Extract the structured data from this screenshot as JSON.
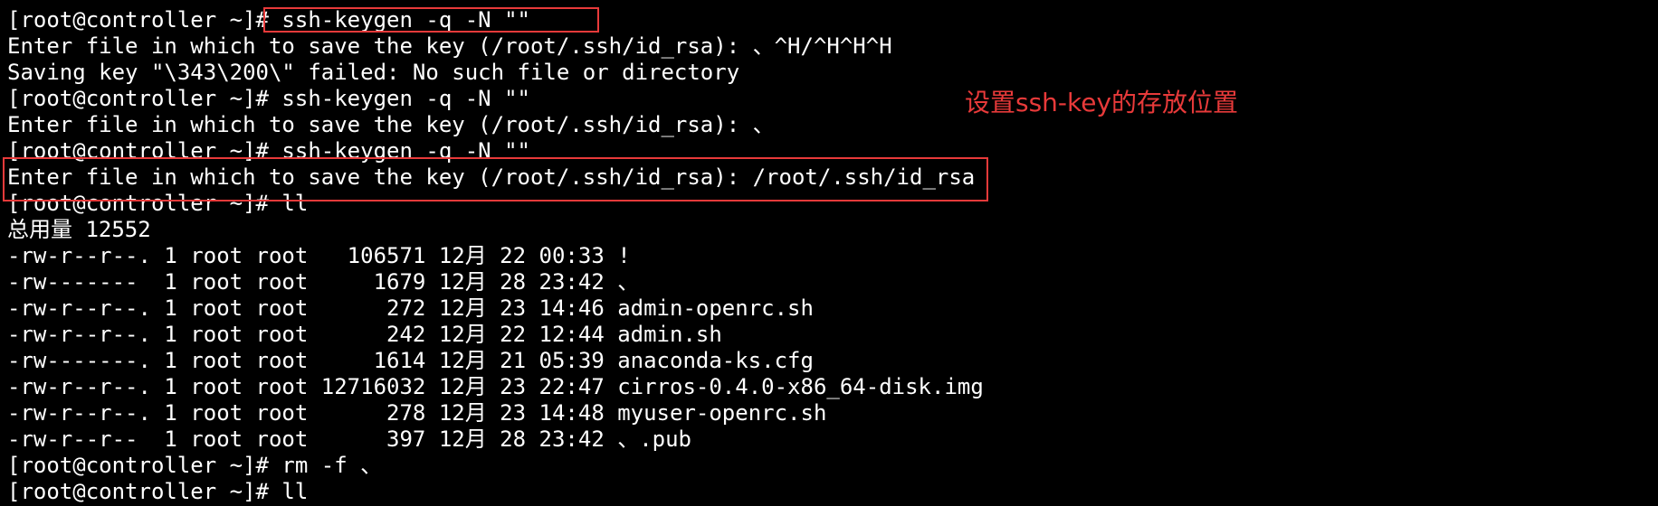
{
  "terminal": {
    "lines": [
      "[root@controller ~]# ssh-keygen -q -N \"\"",
      "Enter file in which to save the key (/root/.ssh/id_rsa): 、^H/^H^H^H",
      "Saving key \"\\343\\200\\\" failed: No such file or directory",
      "[root@controller ~]# ssh-keygen -q -N \"\"",
      "Enter file in which to save the key (/root/.ssh/id_rsa): 、",
      "[root@controller ~]# ssh-keygen -q -N \"\"",
      "Enter file in which to save the key (/root/.ssh/id_rsa): /root/.ssh/id_rsa",
      "[root@controller ~]# ll",
      "总用量 12552",
      "-rw-r--r--. 1 root root   106571 12月 22 00:33 !",
      "-rw-------  1 root root     1679 12月 28 23:42 、",
      "-rw-r--r--. 1 root root      272 12月 23 14:46 admin-openrc.sh",
      "-rw-r--r--. 1 root root      242 12月 22 12:44 admin.sh",
      "-rw-------. 1 root root     1614 12月 21 05:39 anaconda-ks.cfg",
      "-rw-r--r--. 1 root root 12716032 12月 23 22:47 cirros-0.4.0-x86_64-disk.img",
      "-rw-r--r--. 1 root root      278 12月 23 14:48 myuser-openrc.sh",
      "-rw-r--r--  1 root root      397 12月 28 23:42 、.pub",
      "[root@controller ~]# rm -f 、",
      "[root@controller ~]# ll"
    ]
  },
  "annotation": {
    "text": "设置ssh-key的存放位置",
    "color": "#e83a3a"
  },
  "colors": {
    "background": "#000000",
    "foreground": "#ffffff",
    "annotation": "#e83a3a"
  }
}
